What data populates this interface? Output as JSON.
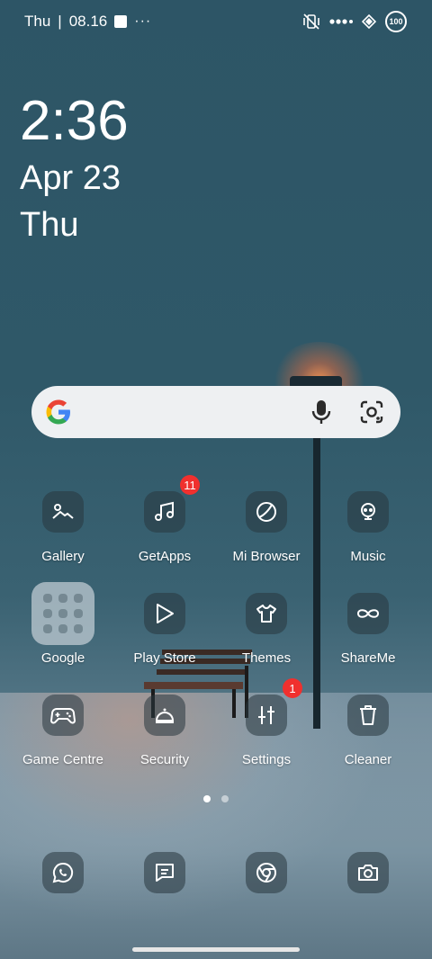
{
  "status_bar": {
    "day": "Thu",
    "time": "08.16",
    "more": "···",
    "battery": "100"
  },
  "lock_clock": {
    "time": "2:36",
    "date": "Apr 23",
    "day": "Thu"
  },
  "search_bar": {
    "logo": "google-g-icon",
    "mic": "mic-icon",
    "lens": "lens-icon"
  },
  "apps": [
    {
      "label": "Gallery",
      "icon": "gallery-icon"
    },
    {
      "label": "GetApps",
      "icon": "getapps-icon",
      "badge": "11"
    },
    {
      "label": "Mi Browser",
      "icon": "browser-icon"
    },
    {
      "label": "Music",
      "icon": "music-icon"
    },
    {
      "label": "Google",
      "icon": "folder-icon"
    },
    {
      "label": "Play Store",
      "icon": "play-store-icon"
    },
    {
      "label": "Themes",
      "icon": "themes-icon"
    },
    {
      "label": "ShareMe",
      "icon": "shareme-icon"
    },
    {
      "label": "Game Centre",
      "icon": "gamepad-icon"
    },
    {
      "label": "Security",
      "icon": "security-icon"
    },
    {
      "label": "Settings",
      "icon": "settings-icon",
      "badge": "1"
    },
    {
      "label": "Cleaner",
      "icon": "cleaner-icon"
    }
  ],
  "dock": [
    {
      "icon": "whatsapp-icon"
    },
    {
      "icon": "messages-icon"
    },
    {
      "icon": "chrome-icon"
    },
    {
      "icon": "camera-icon"
    }
  ],
  "page_indicator": {
    "pages": 2,
    "current": 1
  }
}
